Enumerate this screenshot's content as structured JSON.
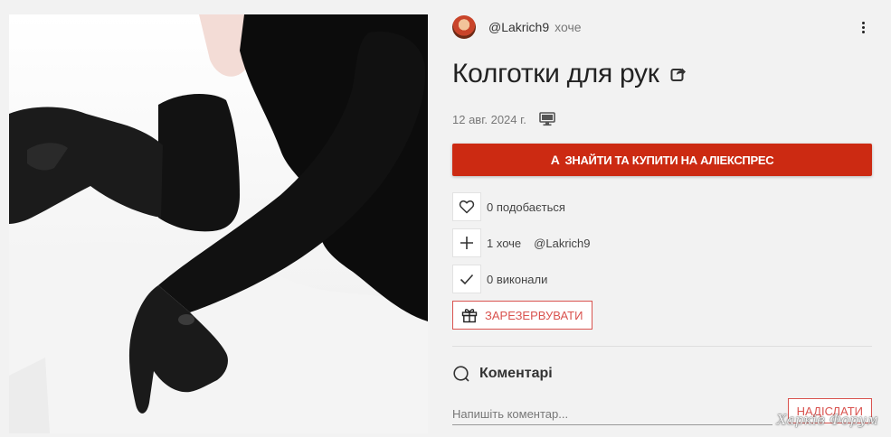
{
  "author": {
    "name": "@Lakrich9",
    "action": "хоче"
  },
  "item": {
    "title": "Колготки для рук",
    "date": "12 авг. 2024 г."
  },
  "buy_button": {
    "glyph": "A",
    "label": "ЗНАЙТИ ТА КУПИТИ НА АЛІЕКСПРЕС"
  },
  "stats": {
    "likes_label": "0 подобається",
    "wants_label": "1 хоче",
    "wants_user": "@Lakrich9",
    "done_label": "0 виконали"
  },
  "reserve_label": "ЗАРЕЗЕРВУВАТИ",
  "comments": {
    "title": "Коментарі",
    "placeholder": "Напишіть коментар...",
    "send_label": "НАДІСЛАТИ"
  },
  "watermark": "Харків Форум",
  "colors": {
    "accent": "#cc2a12",
    "outline_red": "#d9534f",
    "background": "#f2f2f2"
  }
}
